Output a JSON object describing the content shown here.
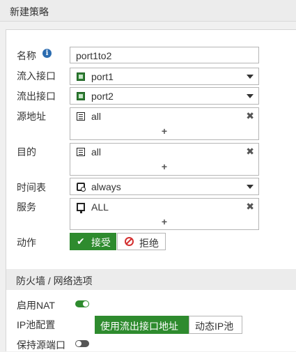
{
  "header": {
    "title": "新建策略"
  },
  "form": {
    "name": {
      "label": "名称",
      "value": "port1to2",
      "info_icon": "i"
    },
    "incoming": {
      "label": "流入接口",
      "value": "port1",
      "icon": "port-icon"
    },
    "outgoing": {
      "label": "流出接口",
      "value": "port2",
      "icon": "port-icon"
    },
    "source": {
      "label": "源地址",
      "value": "all",
      "icon": "address-icon",
      "remove": "✖",
      "add": "+"
    },
    "destination": {
      "label": "目的",
      "value": "all",
      "icon": "address-icon",
      "remove": "✖",
      "add": "+"
    },
    "schedule": {
      "label": "时间表",
      "value": "always",
      "icon": "schedule-icon"
    },
    "service": {
      "label": "服务",
      "value": "ALL",
      "icon": "service-icon",
      "remove": "✖",
      "add": "+"
    },
    "action": {
      "label": "动作",
      "accept": "接受",
      "accept_icon": "✔",
      "deny": "拒绝"
    }
  },
  "firewall": {
    "section_title": "防火墙 / 网络选项",
    "nat": {
      "label": "启用NAT",
      "enabled": true
    },
    "ip_pool": {
      "label": "IP池配置",
      "option_selected": "使用流出接口地址",
      "option_other": "动态IP池"
    },
    "preserve_port": {
      "label": "保持源端口",
      "enabled": false
    }
  },
  "colors": {
    "accent": "#2e8b2e",
    "deny": "#d32f2f",
    "info": "#2b6cb0"
  }
}
